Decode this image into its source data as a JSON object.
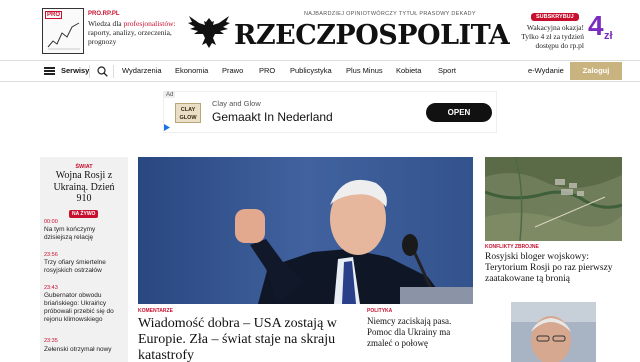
{
  "header": {
    "promo_left": {
      "kicker": "PRO.RP.PL",
      "badge": "PRO",
      "line1_a": "Wiedza dla ",
      "line1_b": "profesjonalistów:",
      "line2": "raporty, analizy, orzeczenia,",
      "line3": "prognozy"
    },
    "tagline": "NAJBARDZIEJ OPINIOTWÓRCZY TYTUŁ PRASOWY DEKADY",
    "logo": "RZECZPOSPOLITA",
    "promo_right": {
      "badge": "SUBSKRYBUJ",
      "line1": "Wakacyjna okazja!",
      "line2": "Tylko 4 zł za tydzień",
      "line3": "dostępu do rp.pl",
      "price": "4",
      "unit": "zł"
    }
  },
  "nav": {
    "serwisy": "Serwisy",
    "items": [
      "Wydarzenia",
      "Ekonomia",
      "Prawo",
      "PRO",
      "Publicystyka",
      "Plus Minus",
      "Kobieta",
      "Sport"
    ],
    "ewydanie": "e-Wydanie",
    "login": "Zaloguj"
  },
  "ad": {
    "tag": "Ad",
    "logo_line1": "CLAY",
    "logo_line2": "GLOW",
    "brand": "Clay and Glow",
    "headline": "Gemaakt In Nederland",
    "cta": "OPEN"
  },
  "live": {
    "tag": "ŚWIAT",
    "title": "Wojna Rosji z Ukrainą. Dzień 910",
    "on_air": "NA ŻYWO",
    "entries": [
      {
        "time": "00:00",
        "text": "Na tym kończymy dzisiejszą relację"
      },
      {
        "time": "23:56",
        "text": "Trzy ofiary śmiertelne rosyjskich ostrzałów"
      },
      {
        "time": "23:43",
        "text": "Gubernator obwodu briańskiego: Ukraińcy próbowali przebić się do rejonu klimowskiego"
      },
      {
        "time": "23:35",
        "text": "Zełenski otrzymał nowy"
      }
    ]
  },
  "main_story": {
    "tag": "KOMENTARZE",
    "headline": "Wiadomość dobra – USA zostają w Europie. Zła – świat staje na skraju katastrofy"
  },
  "side_story": {
    "tag": "POLITYKA",
    "headline": "Niemcy zaciskają pasa. Pomoc dla Ukrainy ma zmaleć o połowę"
  },
  "right_story": {
    "tag": "KONFLIKTY ZBROJNE",
    "headline": "Rosyjski bloger wojskowy: Terytorium Rosji po raz pierwszy zaatakowane tą bronią"
  }
}
